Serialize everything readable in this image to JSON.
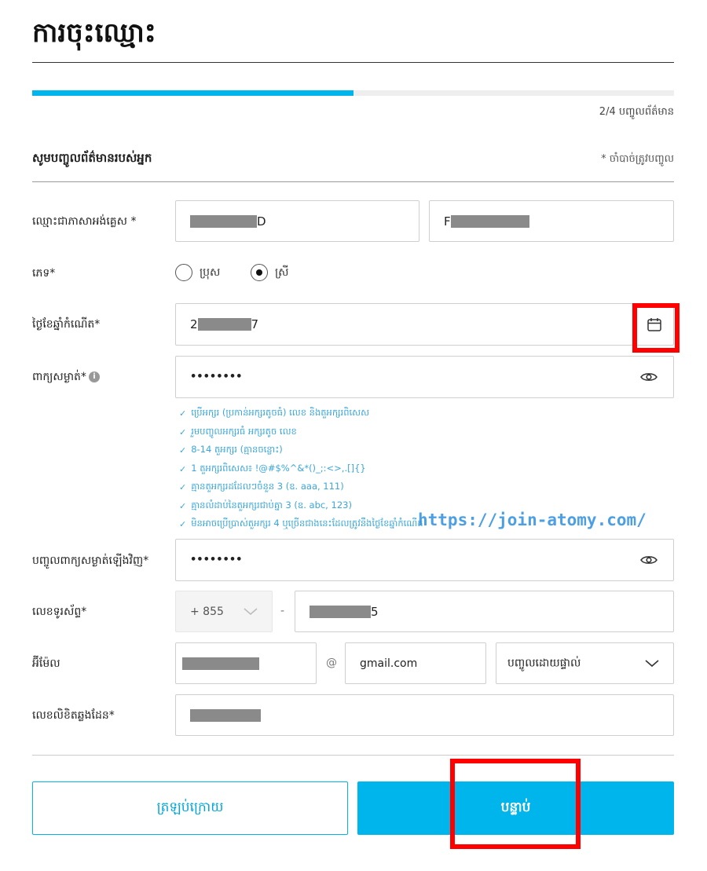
{
  "page": {
    "title": "ការចុះឈ្មោះ",
    "progress": 0.5,
    "step_text": "2/4 បញ្ចូលព័ត៌មាន"
  },
  "section": {
    "title": "សូមបញ្ចូលព័ត៌មានរបស់អ្នក",
    "required_note": "* ចាំបាច់ត្រូវបញ្ចូល"
  },
  "form": {
    "name": {
      "label": "ឈ្មោះជាភាសាអង់គ្លេស *",
      "first_prefix": "",
      "first_suffix": "D",
      "last_prefix": "F",
      "last_suffix": ""
    },
    "gender": {
      "label": "ភេទ*",
      "options": [
        "ប្រុស",
        "ស្រី"
      ],
      "selected": "ស្រី"
    },
    "dob": {
      "label": "ថ្ងៃខែឆ្នាំកំណើត*",
      "value_prefix": "2",
      "value_suffix": "7",
      "icon": "calendar-icon"
    },
    "password": {
      "label": "ពាក្យសម្ងាត់*",
      "value": "••••••••",
      "info_icon": "i",
      "rules": [
        "ប្រើអក្សរ (ប្រកាន់អក្សរតូចធំ) លេខ និងតួអក្សរពិសេស",
        "រួមបញ្ចូលអក្សរធំ អក្សរតូច លេខ",
        "8-14 តួអក្សរ (គ្មានចន្លោះ)",
        "1 តួអក្សរពិសេស៖ !@#$%^&*()_;:<>,.[]{}",
        "គ្មានតួអក្សរដដែលៗចំនួន 3 (ឧ. aaa, 111)",
        "គ្មានលំដាប់នៃតួអក្សរជាប់គ្នា 3 (ឧ. abc, 123)",
        "មិនអាចប្រើប្រាស់តួអក្សរ 4 ឬច្រើនជាងនេះដែលត្រូវនឹងថ្ងៃខែឆ្នាំកំណើត"
      ]
    },
    "password_confirm": {
      "label": "បញ្ចូលពាក្យសម្ងាត់ឡើងវិញ*",
      "value": "••••••••"
    },
    "phone": {
      "label": "លេខទូរស័ព្ទ*",
      "country_code": "+ 855",
      "separator": "-",
      "number_suffix": "5"
    },
    "email": {
      "label": "អ៊ីម៉ែល",
      "at": "@",
      "domain": "gmail.com",
      "domain_select": "បញ្ចូលដោយផ្ទាល់"
    },
    "passport": {
      "label": "លេខលិខិតឆ្លងដែន*"
    }
  },
  "watermark": "https://join-atomy.com/",
  "buttons": {
    "back": "ត្រឡប់ក្រោយ",
    "next": "បន្ទាប់"
  },
  "colors": {
    "accent": "#00b5ec",
    "rule_text": "#3aa6d9",
    "highlight": "#ff0000"
  }
}
